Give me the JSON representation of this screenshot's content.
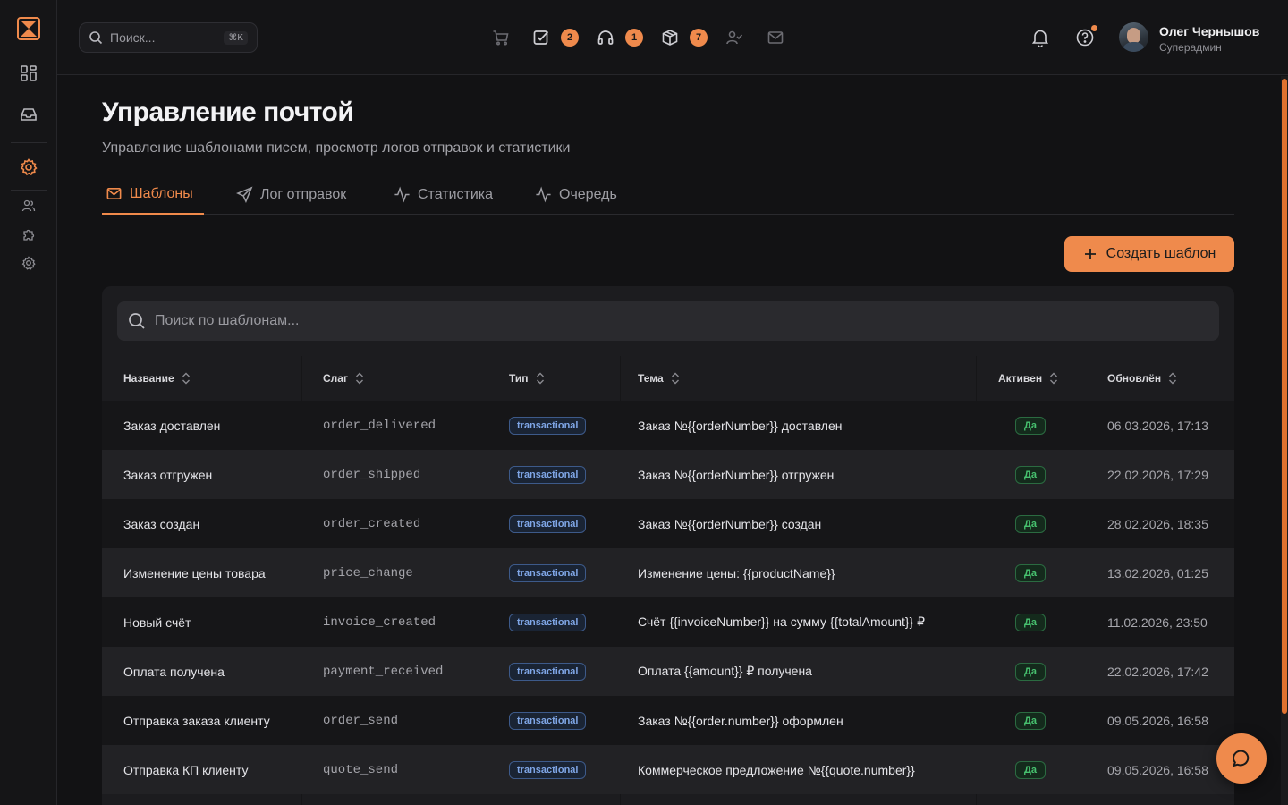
{
  "colors": {
    "accent": "#ef8a4c",
    "background": "#121214",
    "success": "#47c26f",
    "info": "#7fa6e6"
  },
  "sidebar": {
    "items": [
      {
        "icon": "dashboard-icon"
      },
      {
        "icon": "inbox-icon"
      },
      {
        "icon": "settings-icon",
        "active": true
      },
      {
        "icon": "users-icon"
      },
      {
        "icon": "puzzle-icon"
      },
      {
        "icon": "gear-icon"
      }
    ]
  },
  "topbar": {
    "search_placeholder": "Поиск...",
    "search_shortcut": "⌘K",
    "badges": {
      "tasks": "2",
      "support": "1",
      "packages": "7"
    },
    "user": {
      "name": "Олег Чернышов",
      "role": "Суперадмин"
    }
  },
  "page": {
    "title": "Управление почтой",
    "subtitle": "Управление шаблонами писем, просмотр логов отправок и статистики",
    "tabs": [
      {
        "label": "Шаблоны",
        "active": true
      },
      {
        "label": "Лог отправок"
      },
      {
        "label": "Статистика"
      },
      {
        "label": "Очередь"
      }
    ],
    "create_button": "Создать шаблон"
  },
  "table": {
    "search_placeholder": "Поиск по шаблонам...",
    "columns": [
      "Название",
      "Слаг",
      "Тип",
      "Тема",
      "Активен",
      "Обновлён"
    ],
    "rows": [
      {
        "name": "Заказ доставлен",
        "slug": "order_delivered",
        "type": "transactional",
        "subject": "Заказ №{{orderNumber}} доставлен",
        "active": "Да",
        "updated": "06.03.2026, 17:13"
      },
      {
        "name": "Заказ отгружен",
        "slug": "order_shipped",
        "type": "transactional",
        "subject": "Заказ №{{orderNumber}} отгружен",
        "active": "Да",
        "updated": "22.02.2026, 17:29"
      },
      {
        "name": "Заказ создан",
        "slug": "order_created",
        "type": "transactional",
        "subject": "Заказ №{{orderNumber}} создан",
        "active": "Да",
        "updated": "28.02.2026, 18:35"
      },
      {
        "name": "Изменение цены товара",
        "slug": "price_change",
        "type": "transactional",
        "subject": "Изменение цены: {{productName}}",
        "active": "Да",
        "updated": "13.02.2026, 01:25"
      },
      {
        "name": "Новый счёт",
        "slug": "invoice_created",
        "type": "transactional",
        "subject": "Счёт {{invoiceNumber}} на сумму {{totalAmount}} ₽",
        "active": "Да",
        "updated": "11.02.2026, 23:50"
      },
      {
        "name": "Оплата получена",
        "slug": "payment_received",
        "type": "transactional",
        "subject": "Оплата {{amount}} ₽ получена",
        "active": "Да",
        "updated": "22.02.2026, 17:42"
      },
      {
        "name": "Отправка заказа клиенту",
        "slug": "order_send",
        "type": "transactional",
        "subject": "Заказ №{{order.number}} оформлен",
        "active": "Да",
        "updated": "09.05.2026, 16:58"
      },
      {
        "name": "Отправка КП клиенту",
        "slug": "quote_send",
        "type": "transactional",
        "subject": "Коммерческое предложение №{{quote.number}}",
        "active": "Да",
        "updated": "09.05.2026, 16:58"
      }
    ]
  }
}
